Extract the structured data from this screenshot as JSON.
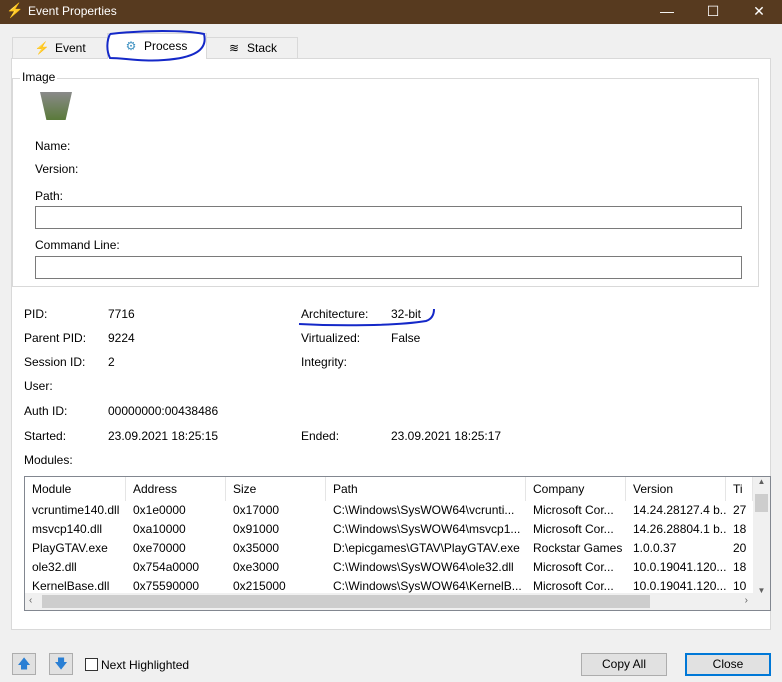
{
  "window": {
    "title": "Event Properties",
    "minimize": "—",
    "maximize": "☐",
    "close": "✕"
  },
  "tabs": [
    {
      "label": "Event",
      "icon": "⚡"
    },
    {
      "label": "Process",
      "icon": "⚙"
    },
    {
      "label": "Stack",
      "icon": "≋"
    }
  ],
  "image": {
    "group_label": "Image",
    "name_label": "Name:",
    "version_label": "Version:",
    "path_label": "Path:",
    "path_value": "",
    "cmd_label": "Command Line:",
    "cmd_value": ""
  },
  "details": {
    "pid_label": "PID:",
    "pid": "7716",
    "ppid_label": "Parent PID:",
    "ppid": "9224",
    "session_label": "Session ID:",
    "session": "2",
    "user_label": "User:",
    "auth_label": "Auth ID:",
    "auth": "00000000:00438486",
    "started_label": "Started:",
    "started": "23.09.2021 18:25:15",
    "arch_label": "Architecture:",
    "arch": "32-bit",
    "virt_label": "Virtualized:",
    "virt": "False",
    "integrity_label": "Integrity:",
    "ended_label": "Ended:",
    "ended": "23.09.2021 18:25:17",
    "modules_label": "Modules:"
  },
  "modules": {
    "columns": [
      "Module",
      "Address",
      "Size",
      "Path",
      "Company",
      "Version",
      "Ti"
    ],
    "rows": [
      [
        "vcruntime140.dll",
        "0x1e0000",
        "0x17000",
        "C:\\Windows\\SysWOW64\\vcrunti...",
        "Microsoft Cor...",
        "14.24.28127.4 b...",
        "27"
      ],
      [
        "msvcp140.dll",
        "0xa10000",
        "0x91000",
        "C:\\Windows\\SysWOW64\\msvcp1...",
        "Microsoft Cor...",
        "14.26.28804.1 b...",
        "18"
      ],
      [
        "PlayGTAV.exe",
        "0xe70000",
        "0x35000",
        "D:\\epicgames\\GTAV\\PlayGTAV.exe",
        "Rockstar Games",
        "1.0.0.37",
        "20"
      ],
      [
        "ole32.dll",
        "0x754a0000",
        "0xe3000",
        "C:\\Windows\\SysWOW64\\ole32.dll",
        "Microsoft Cor...",
        "10.0.19041.120...",
        "18"
      ],
      [
        "KernelBase.dll",
        "0x75590000",
        "0x215000",
        "C:\\Windows\\SysWOW64\\KernelB...",
        "Microsoft Cor...",
        "10.0.19041.120...",
        "10"
      ]
    ]
  },
  "footer": {
    "up": "🡅",
    "down": "🡇",
    "next_highlighted": "Next Highlighted",
    "copy_all": "Copy All",
    "close": "Close"
  },
  "colors": {
    "titlebar": "#573a1f",
    "annotation": "#1428c8"
  }
}
